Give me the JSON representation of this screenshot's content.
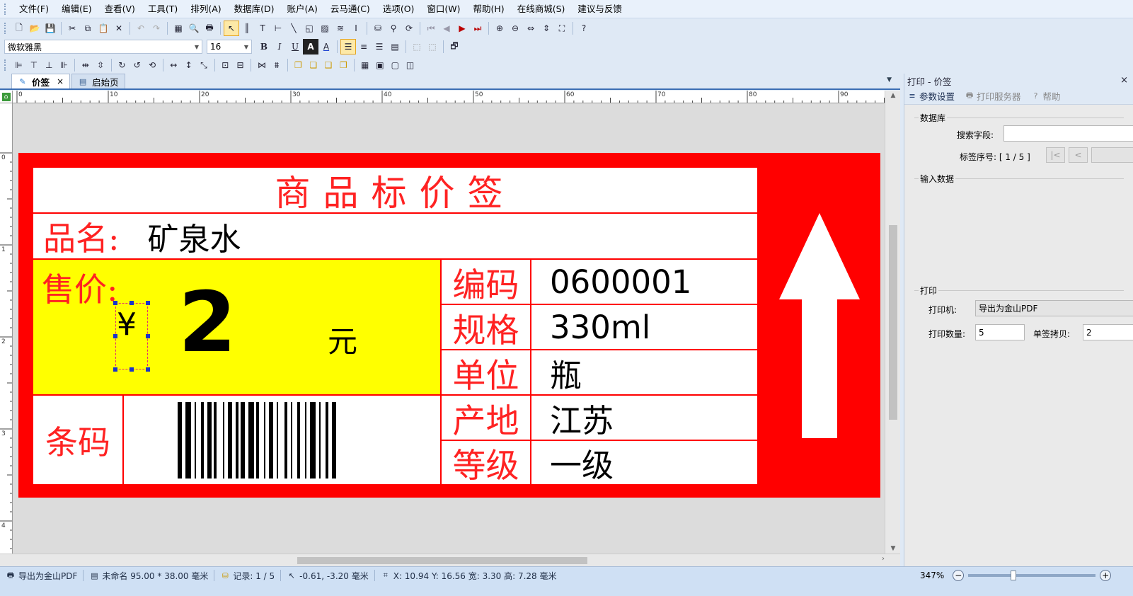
{
  "menu": [
    "文件(F)",
    "编辑(E)",
    "查看(V)",
    "工具(T)",
    "排列(A)",
    "数据库(D)",
    "账户(A)",
    "云马通(C)",
    "选项(O)",
    "窗口(W)",
    "帮助(H)",
    "在线商城(S)",
    "建议与反馈"
  ],
  "font_toolbar": {
    "font_name": "微软雅黑",
    "font_size": "16"
  },
  "doc_tabs": [
    {
      "label": "价签",
      "active": true,
      "closable": true
    },
    {
      "label": "启始页",
      "active": false,
      "closable": false
    }
  ],
  "ruler": {
    "top_labels": [
      "0",
      "10",
      "20",
      "30",
      "40",
      "50",
      "60",
      "70",
      "80",
      "90"
    ],
    "left_labels": [
      "0",
      "1",
      "2",
      "3",
      "4"
    ]
  },
  "label": {
    "title": "商品标价签",
    "name_key": "品名:",
    "name_value": "矿泉水",
    "price_key": "售价:",
    "currency": "¥",
    "price": "2",
    "unit": "元",
    "barcode_key": "条码",
    "specs": [
      {
        "key": "编码",
        "value": "0600001"
      },
      {
        "key": "规格",
        "value": "330ml"
      },
      {
        "key": "单位",
        "value": "瓶"
      },
      {
        "key": "产地",
        "value": "江苏"
      },
      {
        "key": "等级",
        "value": "一级"
      }
    ],
    "colors": {
      "frame": "#ff0000",
      "price_bg": "#ffff00",
      "text_red": "#ff2222"
    }
  },
  "panel": {
    "title": "打印 - 价签",
    "tabs": [
      {
        "label": "参数设置",
        "icon": "settings-icon",
        "active": true
      },
      {
        "label": "打印服务器",
        "icon": "printer-icon",
        "active": false
      },
      {
        "label": "帮助",
        "icon": "help-icon",
        "active": false
      }
    ],
    "database_group": "数据库",
    "search_field_label": "搜索字段:",
    "search_field_value": "",
    "label_index_label": "标签序号: [ 1 / 5 ]",
    "input_data_group": "输入数据",
    "print_group": "打印",
    "printer_label": "打印机:",
    "printer_value": "导出为金山PDF",
    "print_count_label": "打印数量:",
    "print_count_value": "5",
    "copies_label": "单签拷贝:",
    "copies_value": "2"
  },
  "status": {
    "printer": "导出为金山PDF",
    "doc": "未命名 95.00 * 38.00 毫米",
    "records": "记录:  1 / 5",
    "cursor": "-0.61,  -3.20 毫米",
    "selection": "X: 10.94  Y: 16.56  宽: 3.30  高: 7.28  毫米",
    "zoom": "347%"
  }
}
